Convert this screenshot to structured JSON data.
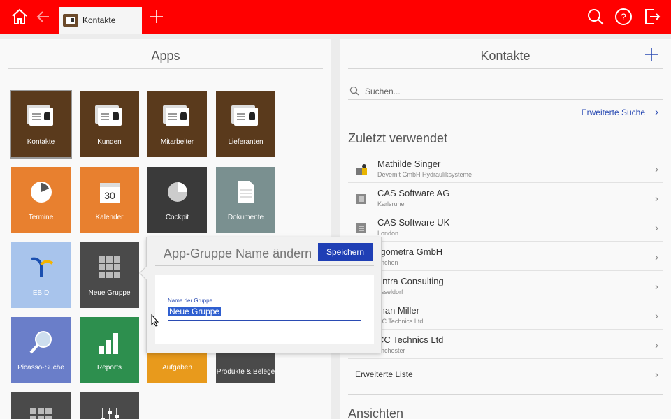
{
  "topbar": {
    "tab_label": "Kontakte",
    "icons": [
      "home-icon",
      "back-arrow-icon",
      "add-tab-icon",
      "search-icon",
      "help-icon",
      "logout-icon"
    ],
    "color": "#ff0000"
  },
  "apps": {
    "title": "Apps",
    "tiles": [
      {
        "label": "Kontakte",
        "color": "#5a3a1c",
        "icon": "contact-card-icon"
      },
      {
        "label": "Kunden",
        "color": "#5a3a1c",
        "icon": "customer-card-icon"
      },
      {
        "label": "Mitarbeiter",
        "color": "#5a3a1c",
        "icon": "employee-card-icon"
      },
      {
        "label": "Lieferanten",
        "color": "#5a3a1c",
        "icon": "supplier-card-icon"
      },
      {
        "label": "Termine",
        "color": "#e8802f",
        "icon": "clock-icon"
      },
      {
        "label": "Kalender",
        "color": "#e8802f",
        "icon": "calendar-icon"
      },
      {
        "label": "Cockpit",
        "color": "#3a3a3a",
        "icon": "pie-chart-icon"
      },
      {
        "label": "Dokumente",
        "color": "#7a9090",
        "icon": "document-icon"
      },
      {
        "label": "EBID",
        "color": "#a8c4ec",
        "icon": "ebid-logo-icon"
      },
      {
        "label": "Neue Gruppe",
        "color": "#4a4a4a",
        "icon": "grid-icon"
      },
      {
        "label": "Picasso-Suche",
        "color": "#6a7ec9",
        "icon": "magnifier-icon"
      },
      {
        "label": "Reports",
        "color": "#2d8f4e",
        "icon": "bar-chart-icon"
      },
      {
        "label": "Aufgaben",
        "color": "#e89a1c",
        "icon": "tasks-icon"
      },
      {
        "label": "Produkte & Belege",
        "color": "#4a4a4a",
        "icon": "products-icon"
      }
    ]
  },
  "popover": {
    "title": "App-Gruppe Name ändern",
    "save_label": "Speichern",
    "field_label": "Name der Gruppe",
    "field_value": "Neue Gruppe"
  },
  "contacts": {
    "title": "Kontakte",
    "search_placeholder": "Suchen...",
    "advanced_search": "Erweiterte Suche",
    "recent_title": "Zuletzt verwendet",
    "recent": [
      {
        "name": "Mathilde Singer",
        "sub": "Devemit GmbH Hydrauliksysteme",
        "icon": "person-building-icon"
      },
      {
        "name": "CAS Software AG",
        "sub": "Karlsruhe",
        "icon": "company-icon"
      },
      {
        "name": "CAS Software UK",
        "sub": "London",
        "icon": "company-icon"
      },
      {
        "name": "rgometra GmbH",
        "sub": "ünchen",
        "icon": "company-icon"
      },
      {
        "name": "entra Consulting",
        "sub": "üsseldorf",
        "icon": "company-icon"
      },
      {
        "name": "than Miller",
        "sub": "CC Technics Ltd",
        "icon": "person-icon"
      },
      {
        "name": "CC Technics Ltd",
        "sub": "anchester",
        "icon": "company-icon"
      }
    ],
    "extended_list": "Erweiterte Liste",
    "views_title": "Ansichten"
  }
}
